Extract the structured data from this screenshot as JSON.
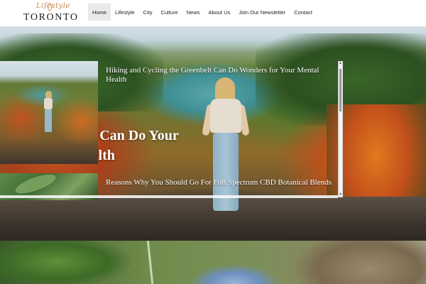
{
  "header": {
    "logo": {
      "script": "Lifestyle",
      "main": "TORONTO"
    },
    "nav": [
      {
        "label": "Home",
        "active": true
      },
      {
        "label": "Lifestyle",
        "active": false
      },
      {
        "label": "City",
        "active": false
      },
      {
        "label": "Culture",
        "active": false
      },
      {
        "label": "News",
        "active": false
      },
      {
        "label": "About Us",
        "active": false
      },
      {
        "label": "Join Our Newsletter",
        "active": false
      },
      {
        "label": "Contact",
        "active": false
      }
    ]
  },
  "hero": {
    "title": "Cycling the Can Do Your Mental Health"
  },
  "slider": {
    "items": [
      {
        "caption": "Hiking and Cycling the Greenbelt Can Do Wonders for Your Mental Health"
      },
      {
        "caption": "Reasons Why You Should Go For Full Spectrum CBD Botanical Blends"
      }
    ]
  },
  "colors": {
    "accent_logo": "#c4864a",
    "nav_active_bg": "#e9e9e9",
    "text_dark": "#222222"
  }
}
